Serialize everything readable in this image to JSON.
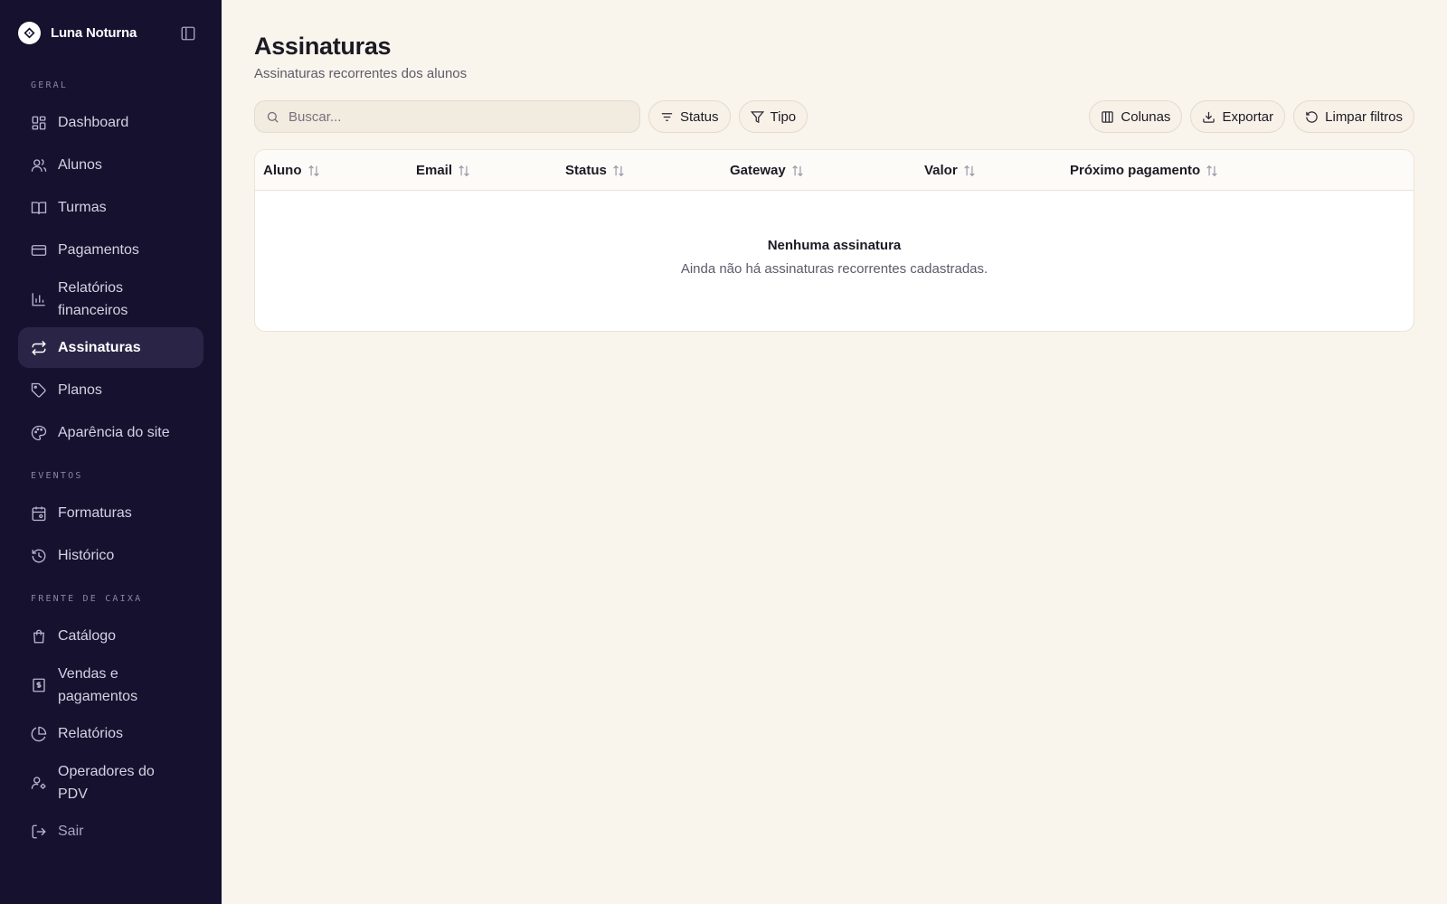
{
  "app": {
    "name": "Luna Noturna"
  },
  "sidebar": {
    "sections": [
      {
        "label": "GERAL",
        "items": [
          {
            "label": "Dashboard",
            "icon": "dashboard-icon"
          },
          {
            "label": "Alunos",
            "icon": "users-icon"
          },
          {
            "label": "Turmas",
            "icon": "book-icon"
          },
          {
            "label": "Pagamentos",
            "icon": "credit-card-icon"
          },
          {
            "label": "Relatórios financeiros",
            "icon": "bar-chart-icon"
          },
          {
            "label": "Assinaturas",
            "icon": "repeat-icon",
            "active": true
          },
          {
            "label": "Planos",
            "icon": "tag-icon"
          },
          {
            "label": "Aparência do site",
            "icon": "palette-icon"
          }
        ]
      },
      {
        "label": "EVENTOS",
        "items": [
          {
            "label": "Formaturas",
            "icon": "calendar-icon"
          },
          {
            "label": "Histórico",
            "icon": "history-icon"
          }
        ]
      },
      {
        "label": "FRENTE DE CAIXA",
        "items": [
          {
            "label": "Catálogo",
            "icon": "shopping-bag-icon"
          },
          {
            "label": "Vendas e pagamentos",
            "icon": "receipt-icon"
          },
          {
            "label": "Relatórios",
            "icon": "pie-chart-icon"
          },
          {
            "label": "Operadores do PDV",
            "icon": "user-cog-icon"
          }
        ]
      }
    ],
    "logout_label": "Sair"
  },
  "page": {
    "title": "Assinaturas",
    "subtitle": "Assinaturas recorrentes dos alunos"
  },
  "toolbar": {
    "search_placeholder": "Buscar...",
    "status_label": "Status",
    "tipo_label": "Tipo",
    "colunas_label": "Colunas",
    "exportar_label": "Exportar",
    "limpar_label": "Limpar filtros"
  },
  "table": {
    "columns": [
      "Aluno",
      "Email",
      "Status",
      "Gateway",
      "Valor",
      "Próximo pagamento"
    ],
    "empty_title": "Nenhuma assinatura",
    "empty_description": "Ainda não há assinaturas recorrentes cadastradas."
  },
  "colors": {
    "sidebar_bg": "#16112f",
    "page_bg": "#f9f4ec",
    "active_item_bg": "#2a2546"
  }
}
